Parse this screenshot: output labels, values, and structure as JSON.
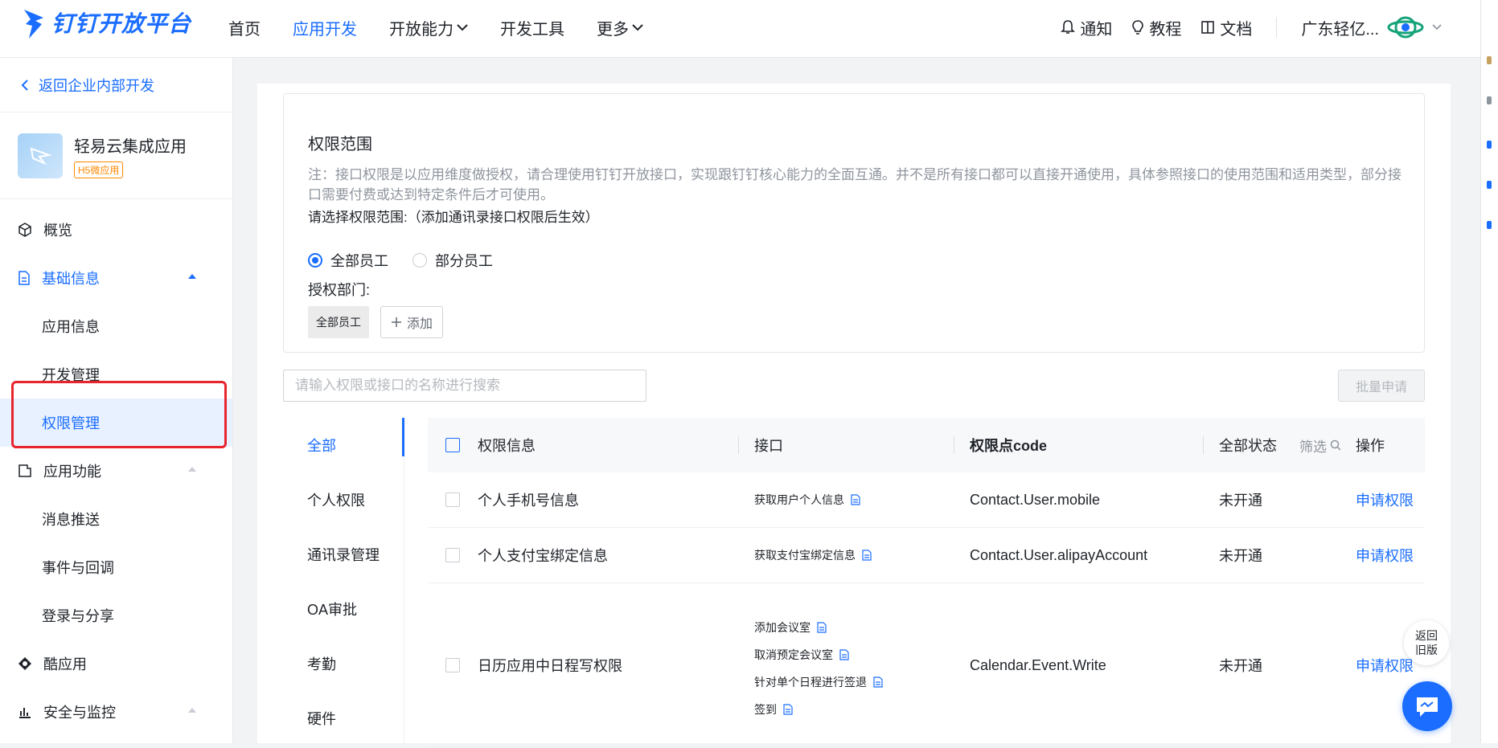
{
  "brand": {
    "name": "钉钉开放平台",
    "color": "#1a6dff"
  },
  "nav": {
    "items": [
      {
        "label": "首页",
        "active": false,
        "dropdown": false
      },
      {
        "label": "应用开发",
        "active": true,
        "dropdown": false
      },
      {
        "label": "开放能力",
        "active": false,
        "dropdown": true
      },
      {
        "label": "开发工具",
        "active": false,
        "dropdown": false
      },
      {
        "label": "更多",
        "active": false,
        "dropdown": true
      }
    ],
    "right": {
      "notify": "通知",
      "tutorial": "教程",
      "docs": "文档",
      "org": "广东轻亿..."
    }
  },
  "sidebar": {
    "back": "返回企业内部开发",
    "app": {
      "name": "轻易云集成应用",
      "badge": "H5微应用"
    },
    "items": [
      {
        "label": "概览",
        "type": "top"
      },
      {
        "label": "基础信息",
        "type": "top"
      },
      {
        "label": "应用信息",
        "type": "sub"
      },
      {
        "label": "开发管理",
        "type": "sub"
      },
      {
        "label": "权限管理",
        "type": "sub"
      },
      {
        "label": "应用功能",
        "type": "top"
      },
      {
        "label": "消息推送",
        "type": "sub"
      },
      {
        "label": "事件与回调",
        "type": "sub"
      },
      {
        "label": "登录与分享",
        "type": "sub"
      },
      {
        "label": "酷应用",
        "type": "top"
      },
      {
        "label": "安全与监控",
        "type": "top"
      }
    ]
  },
  "scope": {
    "title": "权限范围",
    "note": "注：接口权限是以应用维度做授权，请合理使用钉钉开放接口，实现跟钉钉核心能力的全面互通。并不是所有接口都可以直接开通使用，具体参照接口的使用范围和适用类型，部分接口需要付费或达到特定条件后才可使用。",
    "choose": "请选择权限范围:（添加通讯录接口权限后生效）",
    "radio_all": "全部员工",
    "radio_part": "部分员工",
    "dept_label": "授权部门:",
    "dept_tag": "全部员工",
    "add": "添加"
  },
  "search": {
    "placeholder": "请输入权限或接口的名称进行搜索"
  },
  "batch_apply": "批量申请",
  "categories": [
    "全部",
    "个人权限",
    "通讯录管理",
    "OA审批",
    "考勤",
    "硬件"
  ],
  "table": {
    "headers": {
      "info": "权限信息",
      "api": "接口",
      "code": "权限点code",
      "status": "全部状态",
      "filter": "筛选",
      "op": "操作"
    },
    "rows": [
      {
        "info": "个人手机号信息",
        "apis": [
          "获取用户个人信息"
        ],
        "code": "Contact.User.mobile",
        "status": "未开通",
        "action": "申请权限"
      },
      {
        "info": "个人支付宝绑定信息",
        "apis": [
          "获取支付宝绑定信息"
        ],
        "code": "Contact.User.alipayAccount",
        "status": "未开通",
        "action": "申请权限"
      },
      {
        "info": "日历应用中日程写权限",
        "apis": [
          "添加会议室",
          "取消预定会议室",
          "针对单个日程进行签退",
          "签到"
        ],
        "code": "Calendar.Event.Write",
        "status": "未开通",
        "action": "申请权限"
      }
    ]
  },
  "float": {
    "back_line1": "返回",
    "back_line2": "旧版"
  }
}
